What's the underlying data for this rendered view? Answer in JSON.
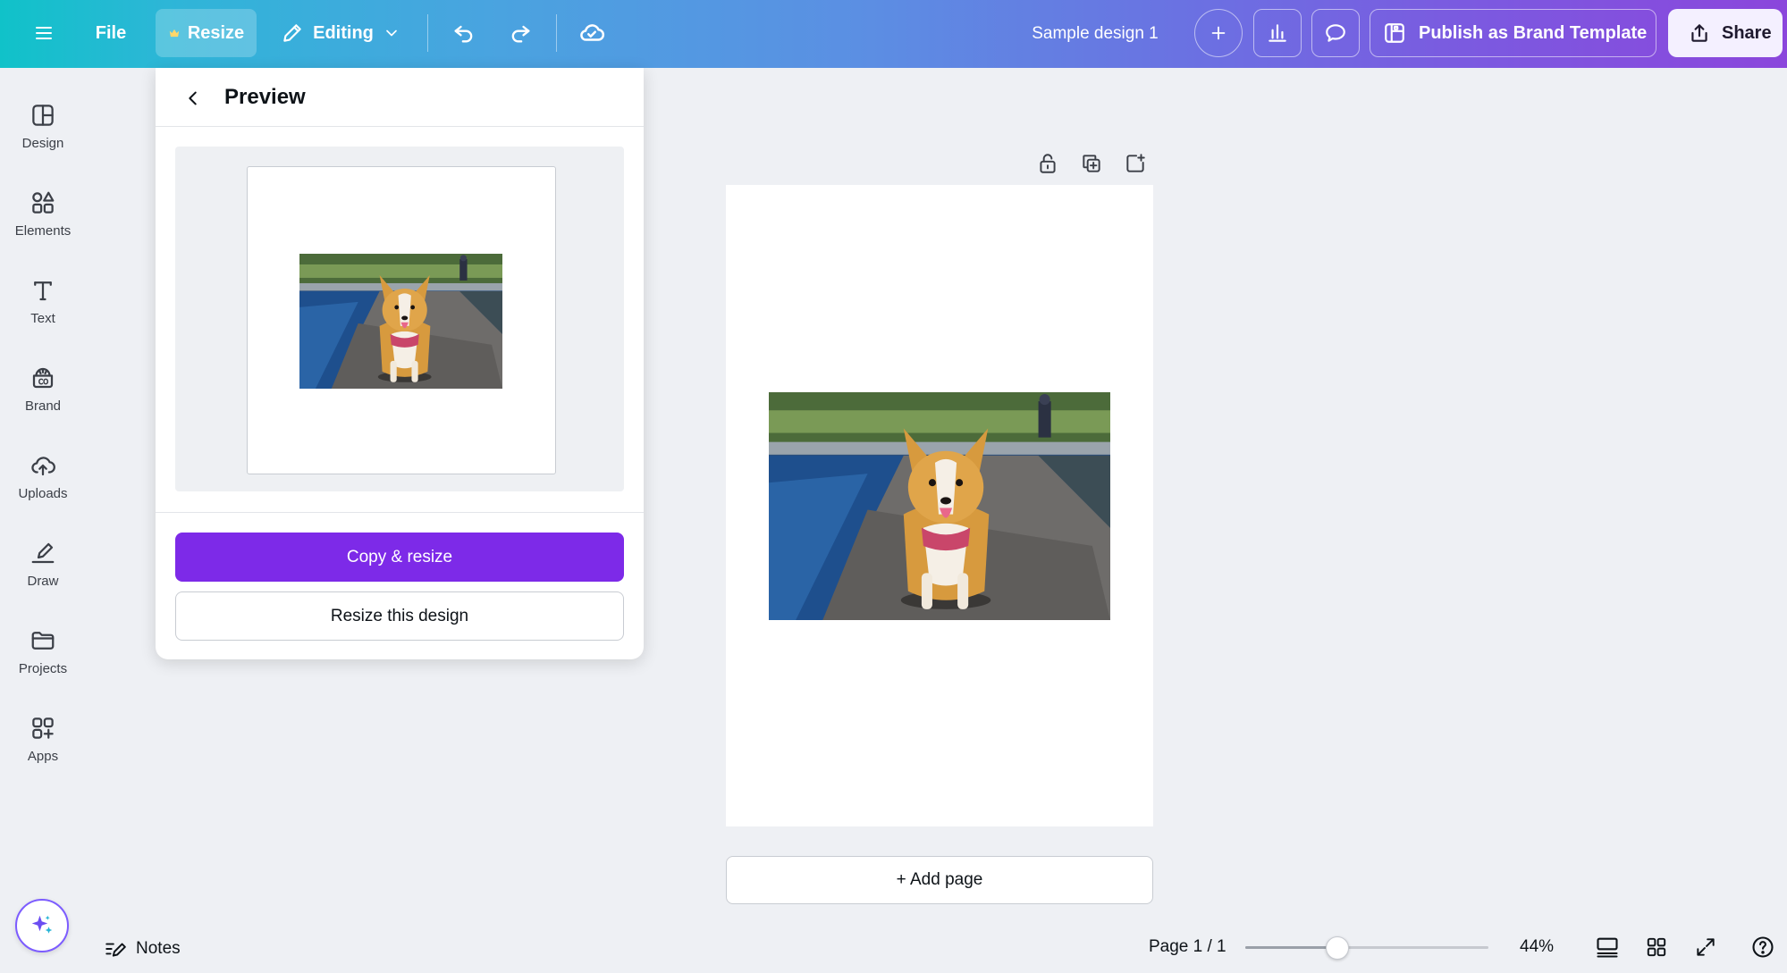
{
  "header": {
    "file_label": "File",
    "resize_label": "Resize",
    "editing_label": "Editing",
    "doc_title": "Sample design 1",
    "publish_label": "Publish as Brand Template",
    "share_label": "Share",
    "gradient_colors": [
      "#10c2c9",
      "#5b8fe3",
      "#8b46dc"
    ]
  },
  "sidebar": {
    "items": [
      {
        "label": "Design",
        "icon": "layout-icon"
      },
      {
        "label": "Elements",
        "icon": "shapes-icon"
      },
      {
        "label": "Text",
        "icon": "text-icon"
      },
      {
        "label": "Brand",
        "icon": "brand-icon"
      },
      {
        "label": "Uploads",
        "icon": "cloud-upload-icon"
      },
      {
        "label": "Draw",
        "icon": "pen-icon"
      },
      {
        "label": "Projects",
        "icon": "folder-icon"
      },
      {
        "label": "Apps",
        "icon": "apps-icon"
      }
    ]
  },
  "panel": {
    "title": "Preview",
    "copy_resize_label": "Copy & resize",
    "resize_this_label": "Resize this design",
    "accent": "#7d2ae8"
  },
  "canvas": {
    "add_page_label": "+ Add page"
  },
  "footer": {
    "notes_label": "Notes",
    "page_indicator": "Page 1 / 1",
    "zoom_label": "44%",
    "zoom_fraction": 0.38
  }
}
